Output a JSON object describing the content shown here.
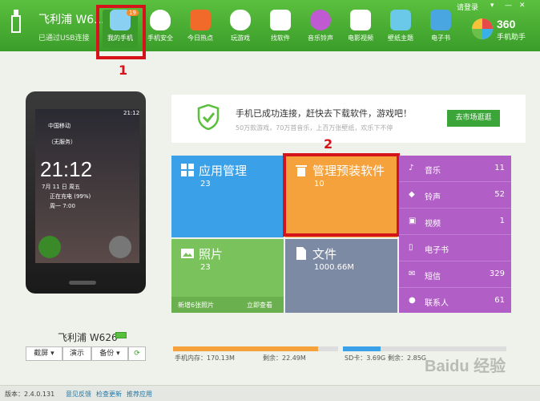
{
  "header": {
    "device_name": "飞利浦 W6...",
    "connection_status": "已通过USB连接",
    "login": "请登录",
    "brand_logo": "360手机助手",
    "nav": [
      {
        "label": "我的手机",
        "badge": "19"
      },
      {
        "label": "手机安全"
      },
      {
        "label": "今日热点"
      },
      {
        "label": "玩游戏"
      },
      {
        "label": "找软件"
      },
      {
        "label": "音乐铃声"
      },
      {
        "label": "电影视频"
      },
      {
        "label": "壁纸主题"
      },
      {
        "label": "电子书"
      }
    ]
  },
  "annotations": {
    "step1": "1",
    "step2": "2"
  },
  "phone": {
    "carrier": "中国移动",
    "service": "（无服务）",
    "time": "21:12",
    "date": "7月 11 日 周五",
    "charging": "正在充电 (99%)",
    "alarm": "周一 7:00",
    "model": "飞利浦 W626",
    "status_time": "21:12"
  },
  "phone_actions": {
    "screenshot": "截屏",
    "present": "演示",
    "backup": "备份"
  },
  "banner": {
    "title": "手机已成功连接，赶快去下载软件，游戏吧！",
    "subtitle": "50万款游戏，70万首音乐，上百万张壁纸，欢乐下不停",
    "market_button": "去市场逛逛"
  },
  "tiles": {
    "app_manage": {
      "title": "应用管理",
      "count": "23"
    },
    "preinstalled": {
      "title": "管理预装软件",
      "count": "10"
    },
    "photos": {
      "title": "照片",
      "count": "23",
      "new": "新增6张照片",
      "view": "立即查看"
    },
    "files": {
      "title": "文件",
      "size": "1000.66M"
    }
  },
  "media": [
    {
      "label": "音乐",
      "count": "11"
    },
    {
      "label": "铃声",
      "count": "52"
    },
    {
      "label": "视频",
      "count": "1"
    },
    {
      "label": "电子书",
      "count": ""
    },
    {
      "label": "短信",
      "count": "329"
    },
    {
      "label": "联系人",
      "count": "61"
    }
  ],
  "storage": {
    "phone_mem": "手机内存：170.13M",
    "phone_free": "剩余：22.49M",
    "phone_used_fraction": 0.88,
    "sd_card": "SD卡：3.69G",
    "sd_free": "剩余：2.85G",
    "sd_used_fraction": 0.23
  },
  "status": {
    "version": "版本：2.4.0.131",
    "feedback": "意见反馈",
    "check_update": "检查更新",
    "recommend": "推荐应用"
  },
  "watermark": "Baidu 经验",
  "colors": {
    "accent": "#3a9d2a",
    "highlight": "#d4141a",
    "tile_blue": "#3aa0e8",
    "tile_orange": "#f6a23c",
    "tile_green": "#7ac35c",
    "tile_gray": "#7d8aa3",
    "tile_purple": "#b25ec7"
  }
}
